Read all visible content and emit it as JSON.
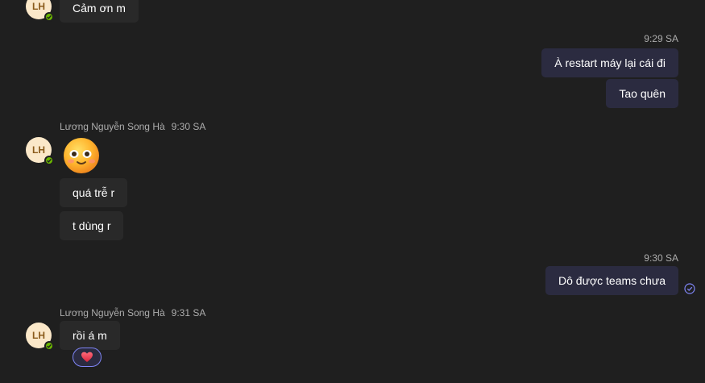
{
  "chat": {
    "partner_initials": "LH",
    "partner_name": "Lương Nguyễn Song Hà",
    "messages_top": {
      "text": "Cảm ơn m"
    },
    "group_out_1": {
      "time": "9:29 SA",
      "messages": [
        "À restart máy lại cái đi",
        "Tao quên"
      ]
    },
    "group_in_1": {
      "name": "Lương Nguyễn Song Hà",
      "time": "9:30 SA",
      "emoji": "smiling-face-emoji",
      "messages": [
        "quá trễ r",
        "t dùng r"
      ]
    },
    "group_out_2": {
      "time": "9:30 SA",
      "messages": [
        "Dô được teams chưa"
      ],
      "status_icon": "seen-check-icon"
    },
    "group_in_2": {
      "name": "Lương Nguyễn Song Hà",
      "time": "9:31 SA",
      "messages": [
        "rồi á m"
      ],
      "reaction": "heart-icon"
    }
  },
  "colors": {
    "background": "#1f1f1f",
    "incoming_bubble": "#292929",
    "outgoing_bubble": "#2b2b40",
    "presence_available": "#6bb700",
    "accent": "#7f85f5",
    "avatar_bg": "#fbe8c9"
  }
}
